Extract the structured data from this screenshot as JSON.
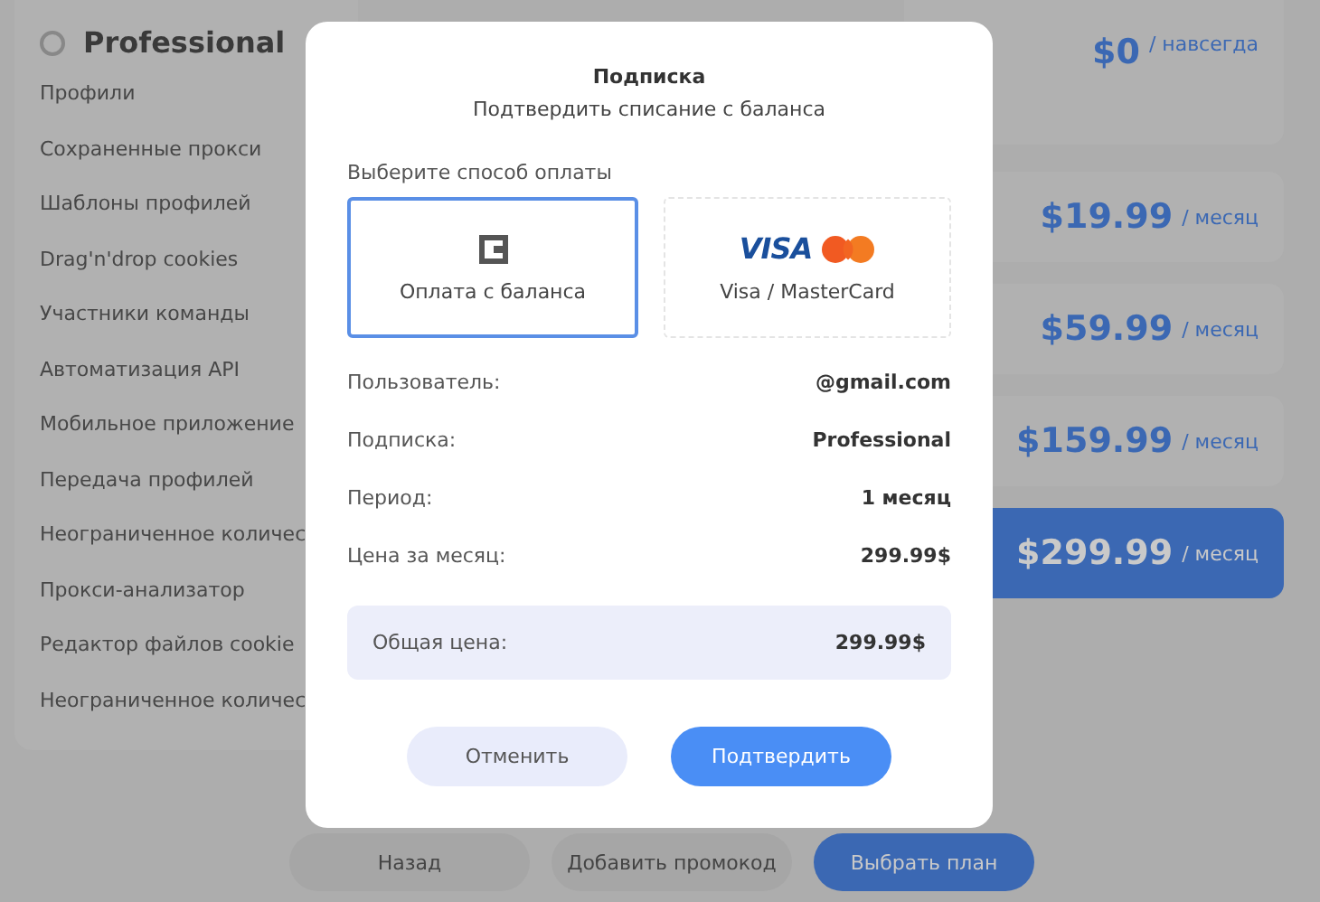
{
  "background": {
    "plan": {
      "name": "Professional",
      "selected": false
    },
    "features": [
      "Профили",
      "Сохраненные прокси",
      "Шаблоны профилей",
      "Drag'n'drop cookies",
      "Участники команды",
      "Автоматизация API",
      "Мобильное приложение",
      "Передача профилей",
      "Неограниченное количес",
      "Прокси-анализатор",
      "Редактор файлов cookie",
      "Неограниченное количес"
    ],
    "prices": [
      {
        "amount": "$0",
        "period": "/ навсегда",
        "selected": false
      },
      {
        "amount": "$19.99",
        "period": "/ месяц",
        "selected": false
      },
      {
        "amount": "$59.99",
        "period": "/ месяц",
        "selected": false
      },
      {
        "amount": "$159.99",
        "period": "/ месяц",
        "selected": false
      },
      {
        "amount": "$299.99",
        "period": "/ месяц",
        "selected": true
      }
    ],
    "buttons": [
      {
        "label": "Назад",
        "kind": "secondary"
      },
      {
        "label": "Добавить промокод",
        "kind": "secondary"
      },
      {
        "label": "Выбрать план",
        "kind": "primary"
      }
    ]
  },
  "modal": {
    "title": "Подписка",
    "subtitle": "Подтвердить списание с баланса",
    "payment_label": "Выберите способ оплаты",
    "payment_methods": [
      {
        "kind": "balance",
        "label": "Оплата с баланса",
        "selected": true
      },
      {
        "kind": "card",
        "logo": "VISA",
        "label": "Visa / MasterCard",
        "selected": false
      }
    ],
    "details": [
      {
        "label": "Пользователь:",
        "value": "@gmail.com"
      },
      {
        "label": "Подписка:",
        "value": "Professional"
      },
      {
        "label": "Период:",
        "value": "1 месяц"
      },
      {
        "label": "Цена за месяц:",
        "value": "299.99$"
      }
    ],
    "total": {
      "label": "Общая цена:",
      "value": "299.99$"
    },
    "buttons": [
      {
        "label": "Отменить",
        "kind": "secondary"
      },
      {
        "label": "Подтвердить",
        "kind": "primary"
      }
    ]
  }
}
